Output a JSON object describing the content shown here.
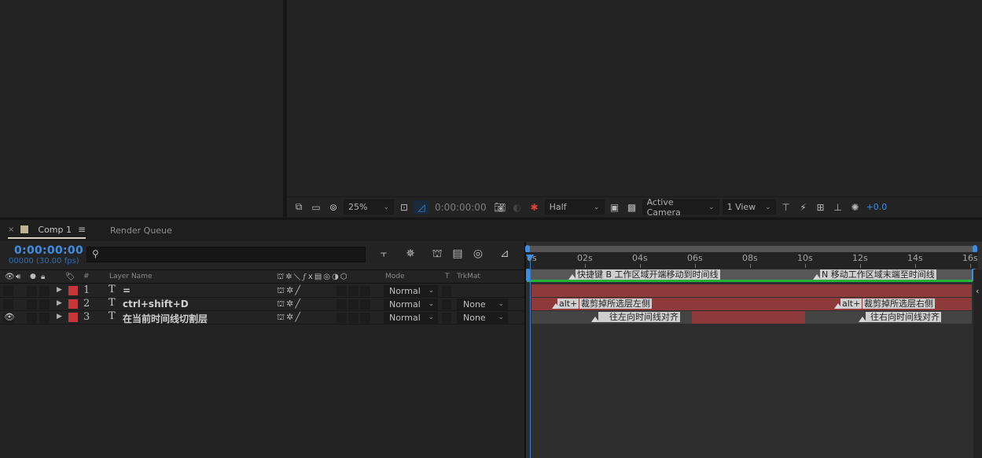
{
  "viewer_toolbar": {
    "zoom": "25%",
    "timecode": "0:00:00:00",
    "resolution": "Half",
    "camera": "Active Camera",
    "views": "1 View",
    "exposure": "+0.0"
  },
  "tabs": {
    "comp": "Comp 1",
    "render_queue": "Render Queue",
    "close": "×",
    "menu": "≡"
  },
  "timeline": {
    "timecode": "0:00:00:00",
    "frame_fps": "00000 (30.00 fps)",
    "search_placeholder": "",
    "columns": {
      "hash": "#",
      "layer_name": "Layer Name",
      "mode": "Mode",
      "t": "T",
      "trkmat": "TrkMat"
    },
    "layers": [
      {
        "num": "1",
        "type": "T",
        "name": "=",
        "mode": "Normal",
        "trkmat": "",
        "visible": false
      },
      {
        "num": "2",
        "type": "T",
        "name": "ctrl+shift+D",
        "mode": "Normal",
        "trkmat": "None",
        "visible": false
      },
      {
        "num": "3",
        "type": "T",
        "name": "在当前时间线切割层",
        "mode": "Normal",
        "trkmat": "None",
        "visible": true
      }
    ],
    "ruler": [
      "0s",
      "02s",
      "04s",
      "06s",
      "08s",
      "10s",
      "12s",
      "14s",
      "16s"
    ],
    "markers": {
      "workarea_start": "快捷键 B   工作区域开端移动到时间线",
      "workarea_end": "N 移动工作区域末端至时间线",
      "layer2_left_key": "alt+",
      "layer2_left": "裁剪掉所选层左侧",
      "layer2_right_key": "alt+",
      "layer2_right": "裁剪掉所选层右侧",
      "layer3_left": "往左向时间线对齐",
      "layer3_right": "往右向时间线对齐"
    }
  },
  "colors": {
    "accent": "#3d8ee0",
    "label_red": "#c8363b",
    "layer_bar": "#8f3a3a",
    "workarea_green": "#22b43a",
    "comp_swatch": "#bfb394"
  }
}
